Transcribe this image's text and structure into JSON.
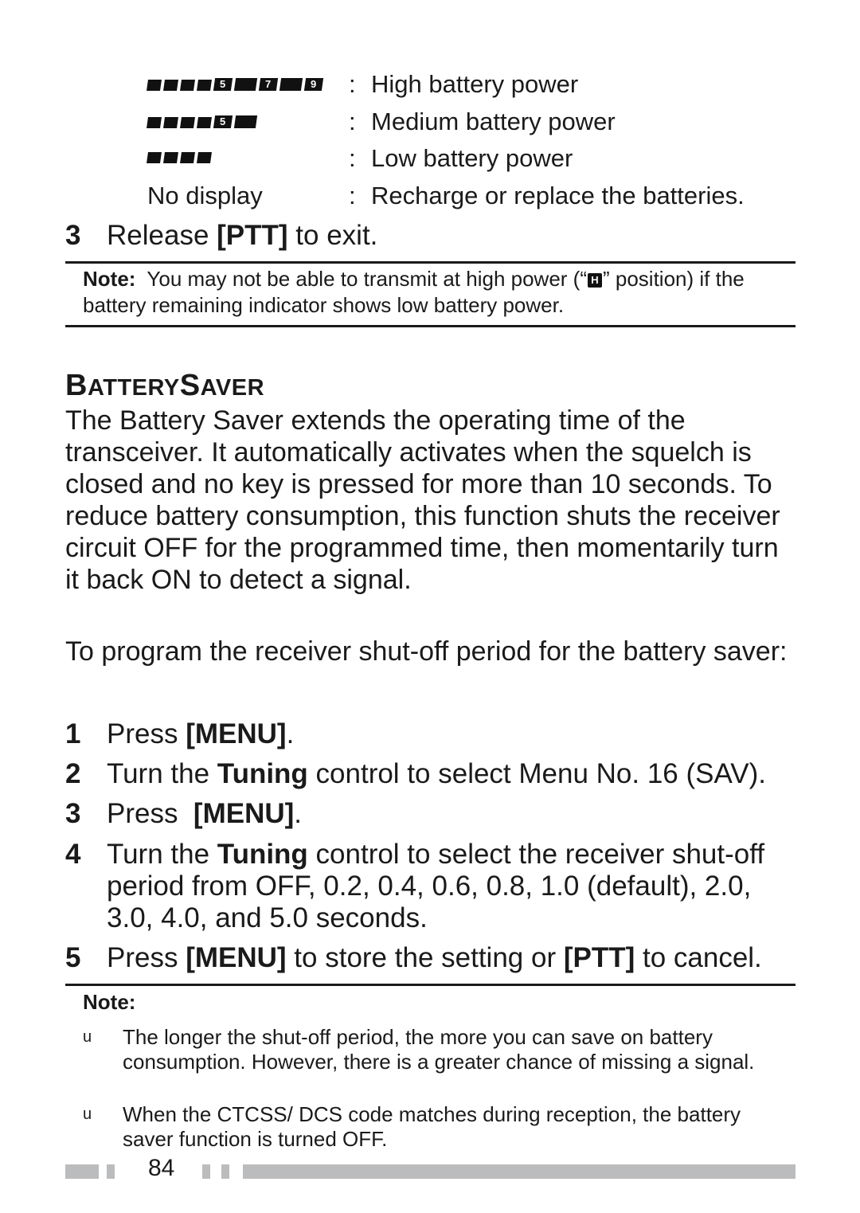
{
  "battery_levels": [
    {
      "indicator": "battery-high",
      "segments_lit": 9,
      "label": "",
      "colon": ":",
      "description": "High battery power"
    },
    {
      "indicator": "battery-medium",
      "segments_lit": 6,
      "label": "",
      "colon": ":",
      "description": "Medium battery power"
    },
    {
      "indicator": "battery-low",
      "segments_lit": 4,
      "label": "",
      "colon": ":",
      "description": "Low battery power"
    },
    {
      "indicator": "none",
      "label": "No display",
      "colon": ":",
      "description": "Recharge or replace the batteries."
    }
  ],
  "indicator_digits": {
    "d5": "5",
    "d7": "7",
    "d9": "9"
  },
  "step3_exit": {
    "num": "3",
    "pre": "Release ",
    "key": "[PTT]",
    "post": " to exit."
  },
  "note1": {
    "label": "Note:",
    "text_a": "You may not be able to transmit at high power (“",
    "icon": "H",
    "text_b": "” position) if the battery remaining indicator shows low battery power."
  },
  "section": {
    "heading_b": "B",
    "heading_attery": "ATTERY",
    "heading_s": "S",
    "heading_aver": "AVER",
    "para1": "The Battery Saver extends the operating time of the transceiver.  It automatically activates when the squelch is closed and no key is pressed for more than 10 seconds.  To reduce battery consumption, this function shuts the receiver circuit OFF for the programmed time, then momentarily turn it back ON to detect a signal.",
    "para2": "To program the receiver shut-off period for the battery saver:"
  },
  "steps": [
    {
      "num": "1",
      "a": "Press ",
      "b": "[MENU]",
      "c": "."
    },
    {
      "num": "2",
      "a": "Turn the ",
      "b": "Tuning",
      "c": " control to select Menu No. 16 (SAV)."
    },
    {
      "num": "3",
      "a": "Press  ",
      "b": "[MENU]",
      "c": "."
    },
    {
      "num": "4",
      "a": "Turn the ",
      "b": "Tuning",
      "c": " control to select the receiver shut-off period from OFF, 0.2, 0.4, 0.6, 0.8, 1.0 (default), 2.0, 3.0, 4.0, and 5.0 seconds."
    },
    {
      "num": "5",
      "a": "Press ",
      "b": "[MENU]",
      "c": " to store the setting or ",
      "d": "[PTT]",
      "e": " to cancel."
    }
  ],
  "note2": {
    "label": "Note:",
    "bullets": [
      {
        "bullet": "u",
        "text": "The longer the shut-off period, the more you can save on battery consumption.  However, there is a greater chance of missing a signal."
      },
      {
        "bullet": "u",
        "text": "When the CTCSS/ DCS code matches during reception, the battery saver function is turned OFF."
      }
    ]
  },
  "footer": {
    "page_number": "84",
    "bar_color": "#bbbcbd"
  }
}
